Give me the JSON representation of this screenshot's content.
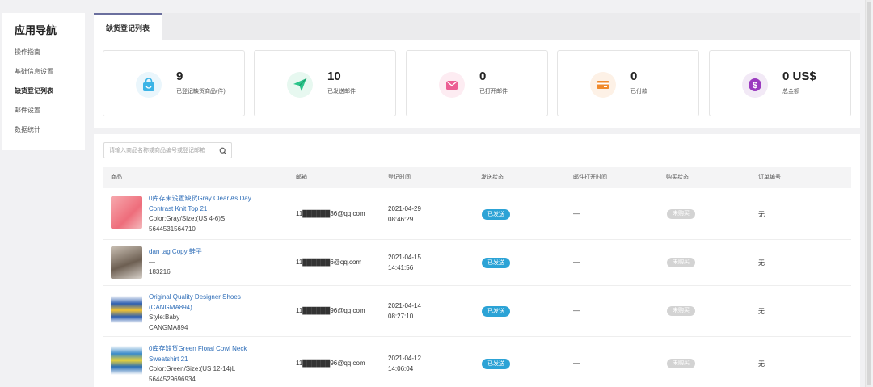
{
  "sidebar": {
    "title": "应用导航",
    "items": [
      {
        "label": "操作指南"
      },
      {
        "label": "基础信息设置"
      },
      {
        "label": "缺货登记列表"
      },
      {
        "label": "邮件设置"
      },
      {
        "label": "数据统计"
      }
    ],
    "active_index": 2
  },
  "tab": {
    "label": "缺货登记列表"
  },
  "stats": [
    {
      "value": "9",
      "label": "已登记缺货商品(件)",
      "icon": "shopping-bag-icon",
      "color": "#3cb4e6",
      "bg": "#eaf6fc"
    },
    {
      "value": "10",
      "label": "已发送邮件",
      "icon": "paper-plane-icon",
      "color": "#2bc48a",
      "bg": "#e7f8f0"
    },
    {
      "value": "0",
      "label": "已打开邮件",
      "icon": "envelope-icon",
      "color": "#ec5f94",
      "bg": "#fdecf2"
    },
    {
      "value": "0",
      "label": "已付款",
      "icon": "payment-card-icon",
      "color": "#f08a2c",
      "bg": "#fdf1e6"
    },
    {
      "value": "0 US$",
      "label": "总金额",
      "icon": "dollar-coin-icon",
      "color": "#9b3bbf",
      "bg": "#f2e9f6"
    }
  ],
  "search": {
    "placeholder": "请输入商品名称或商品编号或登记邮箱"
  },
  "table": {
    "headers": [
      "商品",
      "邮箱",
      "登记时间",
      "发送状态",
      "邮件打开时间",
      "购买状态",
      "订单编号"
    ],
    "rows": [
      {
        "product_name": "0库存未设置缺货Gray Clear As Day Contrast Knit Top 21",
        "meta1": "Color:Gray/Size:(US 4-6)S",
        "meta2": "5644531564710",
        "email": "11██████36@qq.com",
        "date": "2021-04-29",
        "time": "08:46:29",
        "send_status": "已发送",
        "open_time": "—",
        "buy_status": "未购买",
        "order_no": "无",
        "thumb_color": "#f07b86"
      },
      {
        "product_name": "dan tag Copy 鞋子",
        "meta1": "—",
        "meta2": "183216",
        "email": "11██████6@qq.com",
        "date": "2021-04-15",
        "time": "14:41:56",
        "send_status": "已发送",
        "open_time": "—",
        "buy_status": "未购买",
        "order_no": "无",
        "thumb_color": "#8a7a6a"
      },
      {
        "product_name": "Original Quality Designer Shoes (CANGMA894)",
        "meta1": "Style:Baby",
        "meta2": "CANGMA894",
        "email": "11██████96@qq.com",
        "date": "2021-04-14",
        "time": "08:27:10",
        "send_status": "已发送",
        "open_time": "—",
        "buy_status": "未购买",
        "order_no": "无",
        "thumb_color": "#2f5fb0"
      },
      {
        "product_name": "0库存缺货Green Floral Cowl Neck Sweatshirt 21",
        "meta1": "Color:Green/Size:(US 12-14)L",
        "meta2": "5644529696934",
        "email": "11██████96@qq.com",
        "date": "2021-04-12",
        "time": "14:06:04",
        "send_status": "已发送",
        "open_time": "—",
        "buy_status": "未购买",
        "order_no": "无",
        "thumb_color": "#3a8ac9"
      }
    ]
  }
}
